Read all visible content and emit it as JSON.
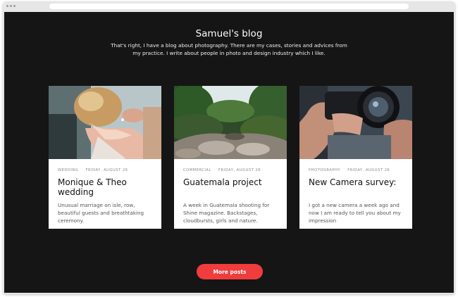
{
  "page": {
    "title": "Samuel's blog",
    "intro": "That's right, I have a blog about photography. There are my cases, stories and advices from my practice. I write about people in photo and design industry which I like."
  },
  "posts": [
    {
      "category": "Wedding",
      "date": "Friday, August 26",
      "title": "Monique & Theo wedding",
      "excerpt": "Unusual marriage on isle, row, beautiful guests and breathtaking ceremony."
    },
    {
      "category": "Commercial",
      "date": "Friday, August 26",
      "title": "Guatemala project",
      "excerpt": "A week in Guatemala shooting for Shine magazine. Backstages, cloudbursts, girls and nature."
    },
    {
      "category": "Photography",
      "date": "Friday, August 26",
      "title": "New Camera survey:",
      "excerpt": "I got a new camera a week ago and now I am ready to tell you about my impression"
    }
  ],
  "more_button": {
    "label": "More posts"
  },
  "colors": {
    "background": "#151515",
    "card": "#ffffff",
    "accent": "#f03c3c",
    "frame": "#e6e6e6"
  }
}
